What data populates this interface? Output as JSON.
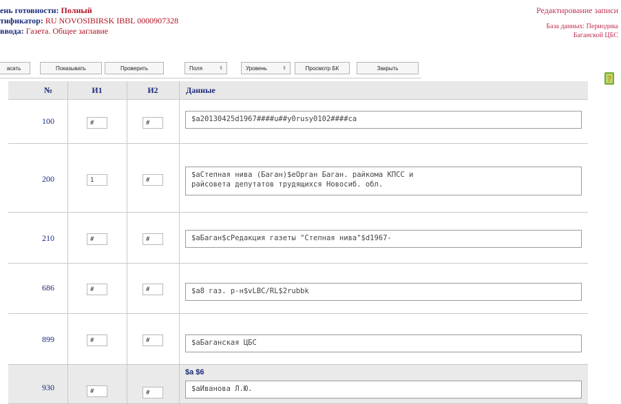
{
  "header": {
    "line1_label": "ень готовности:",
    "line1_value": "Полный",
    "line2_label": "тификатор:",
    "line2_value": "RU NOVOSIBIRSK IBBL 0000907328",
    "line3_label": "ввода:",
    "line3_value": "Газета. Общее заглавие",
    "edit_title": "Редактирование записи",
    "db_label": "База данных: Периодика",
    "db_value": "Баганской ЦБС"
  },
  "toolbar": {
    "btn_save": "асать",
    "btn_show": "Показывать",
    "btn_check": "Проверить",
    "sel_fields": "Поля",
    "sel_level": "Уровень",
    "btn_view": "Просмотр БК",
    "btn_close": "Закрыть"
  },
  "table": {
    "headers": [
      "№",
      "И1",
      "И2",
      "Данные"
    ],
    "rows": [
      {
        "num": "100",
        "i1": "#",
        "i2": "#",
        "data": "$a20130425d1967####u##y0rusy0102####ca",
        "subfields": ""
      },
      {
        "num": "200",
        "i1": "1",
        "i2": "#",
        "data": "$aСтепная нива (Баган)$eОрган Баган. райкома КПСС и\nрайсовета депутатов трудящихся Новосиб. обл.",
        "subfields": ""
      },
      {
        "num": "210",
        "i1": "#",
        "i2": "#",
        "data": "$aБаган$cРедакция газеты \"Степная нива\"$d1967-",
        "subfields": ""
      },
      {
        "num": "686",
        "i1": "#",
        "i2": "#",
        "data": "$a8 газ. р-н$vLBC/RL$2rubbk",
        "subfields": ""
      },
      {
        "num": "899",
        "i1": "#",
        "i2": "#",
        "data": "$aБаганская ЦБС",
        "subfields": ""
      },
      {
        "num": "930",
        "i1": "#",
        "i2": "#",
        "data": "$aИванова Л.Ю.",
        "subfields": "$a $6"
      }
    ]
  },
  "colors": {
    "header_blue": "#1a2a7a",
    "status_red": "#b01020",
    "header_bg": "#e8e8e8"
  }
}
